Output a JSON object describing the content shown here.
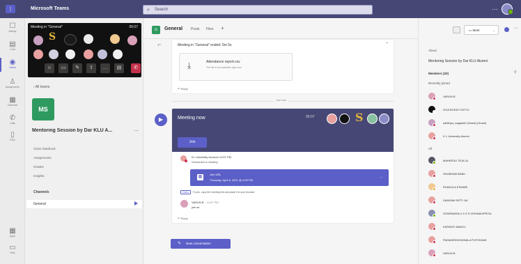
{
  "titlebar": {
    "app_name": "Microsoft Teams",
    "search_placeholder": "Search"
  },
  "rail": [
    {
      "label": "Activity",
      "icon": "bell-icon",
      "glyph": "☐"
    },
    {
      "label": "Chat",
      "icon": "chat-icon",
      "glyph": "▤"
    },
    {
      "label": "Teams",
      "icon": "teams-icon",
      "glyph": "◉",
      "active": true
    },
    {
      "label": "Assignments",
      "icon": "assignments-icon",
      "glyph": "♙"
    },
    {
      "label": "Calendar",
      "icon": "calendar-icon",
      "glyph": "▦"
    },
    {
      "label": "Calls",
      "icon": "phone-icon",
      "glyph": "✆"
    },
    {
      "label": "Files",
      "icon": "file-icon",
      "glyph": "▯"
    },
    {
      "label": "Apps",
      "icon": "apps-icon",
      "glyph": "▦"
    },
    {
      "label": "Help",
      "icon": "help-icon",
      "glyph": "▭"
    }
  ],
  "meeting_pip": {
    "title": "Meeting in \"General\"",
    "timer": "05:07"
  },
  "teampane": {
    "back_label": "All teams",
    "team_initials": "MS",
    "team_name": "Mentoring Session by Dar KLU A...",
    "links": [
      "Class Notebook",
      "Assignments",
      "Grades",
      "Insights"
    ],
    "channels_heading": "Channels",
    "channel": "General"
  },
  "channel_header": {
    "avatar": "G",
    "name": "General",
    "tabs": [
      "Posts",
      "Files"
    ],
    "add": "+"
  },
  "card1": {
    "header": "Meeting in \"General\" ended: 5m 5s",
    "file_name": "Attendance report.csv",
    "file_sub": "The file is not available right now",
    "reply": "Reply"
  },
  "divider_label": "Last read",
  "card2": {
    "banner_title": "Meeting now",
    "banner_time": "05:07",
    "join_label": "Join",
    "event1_name": "KL University Account   14:57 PM",
    "event1_sub": "Scheduled a meeting",
    "sched_title": "Join URL",
    "sched_time": "Thursday, April 8, 2021 @ 4:00 PM",
    "note_badge": "Class",
    "note_text": "To join, copy the meeting link and paste it in your browser",
    "event2_name": "VARUN B",
    "event2_time": "14:57 PM",
    "event2_text": "join sir",
    "reply": "Reply"
  },
  "new_conversation": "New conversation",
  "right": {
    "meet_button": "Meet",
    "about_label": "About",
    "meeting_title": "Mentoring Session by Dar KLU Alumni",
    "members_label": "Members (20)",
    "recently_label": "Recently joined",
    "members_recent": [
      {
        "name": "VARUN B",
        "color": "#d9a0b8",
        "status": "#c4314b"
      },
      {
        "name": "2018 BODDY MITTU",
        "color": "#111111",
        "status": "#ffffff"
      },
      {
        "name": "sahithya_nagaselri (Guest)   (Guest)",
        "color": "#c9a0c0",
        "status": "#c4314b"
      },
      {
        "name": "K L University Alumni",
        "color": "#e8a0a0",
        "status": "#c4314b"
      }
    ],
    "all_label": "All",
    "members_all": [
      {
        "name": "MAHEEDU TEJA 24",
        "color": "#555566",
        "status": "#6bb700"
      },
      {
        "name": "SHUBHAM BABU",
        "color": "#e8a0a0",
        "status": "#c4314b"
      },
      {
        "name": "RHAKULA ESWARI",
        "color": "#f0c890",
        "status": "#e1b33c"
      },
      {
        "name": "DANDAM DIPTI JAI",
        "color": "#e8a0a0",
        "status": "#c4314b"
      },
      {
        "name": "GOWRAMOLU S S S VISHNAVIPRIYA",
        "color": "#8a8fb0",
        "status": "#6bb700"
      },
      {
        "name": "KARANTI MANOJ",
        "color": "#e8a0a0",
        "status": "#c4314b"
      },
      {
        "name": "PADMARIKKISANALA PUTHIVAMI",
        "color": "#e8a0a0",
        "status": "#c4314b"
      },
      {
        "name": "VARUN B",
        "color": "#d9a0b8",
        "status": "#c4314b"
      }
    ]
  }
}
